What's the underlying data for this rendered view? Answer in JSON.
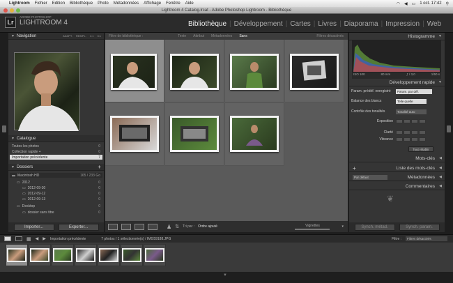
{
  "menubar": {
    "app": "Lightroom",
    "items": [
      "Fichier",
      "Edition",
      "Bibliothèque",
      "Photo",
      "Métadonnées",
      "Affichage",
      "Fenêtre",
      "Aide"
    ],
    "clock": "1 oct. 17:42"
  },
  "window": {
    "title": "Lightroom 4 Catalog.lrcat - Adobe Photoshop Lightroom - Bibliothèque"
  },
  "brand": {
    "logo": "Lr",
    "small": "ADOBE PHOTOSHOP",
    "big": "LIGHTROOM 4"
  },
  "modules": [
    "Bibliothèque",
    "Développement",
    "Cartes",
    "Livres",
    "Diaporama",
    "Impression",
    "Web"
  ],
  "left": {
    "navigation": {
      "title": "Navigation",
      "zooms": [
        "ADAPT.",
        "REMPL.",
        "1:1",
        "3:1"
      ]
    },
    "catalogue": {
      "title": "Catalogue",
      "items": [
        {
          "label": "Toutes les photos",
          "count": "0"
        },
        {
          "label": "Collection rapide +",
          "count": "0"
        },
        {
          "label": "Importation précédente",
          "count": "7"
        }
      ]
    },
    "dossiers": {
      "title": "Dossiers",
      "volume": "Macintosh HD",
      "volume_info": "165 / 233 Go",
      "items": [
        {
          "label": "2012",
          "count": "0"
        },
        {
          "label": "2012-09-30",
          "count": "0"
        },
        {
          "label": "2012-09-12",
          "count": "0"
        },
        {
          "label": "2012-09-13",
          "count": "0"
        },
        {
          "label": "Desktop",
          "count": "0"
        },
        {
          "label": "dossier sans titre",
          "count": "0"
        }
      ]
    },
    "import_label": "Importer...",
    "export_label": "Exporter..."
  },
  "filter": {
    "label": "Filtre de bibliothèque :",
    "items": [
      "Texte",
      "Attribut",
      "Métadonnées",
      "Sans"
    ],
    "status": "Filtres désactivés"
  },
  "toolbar": {
    "sort_label": "Tri par :",
    "sort_value": "Ordre ajouté",
    "thumbs_label": "Vignettes"
  },
  "right": {
    "histogram": {
      "title": "Histogramme",
      "info": [
        "ISO 100",
        "80 mm",
        "ƒ / 3,0",
        "1/50 s"
      ]
    },
    "quick": {
      "title": "Développement rapide",
      "preset_label": "Param. prédéf. enregistré",
      "preset_value": "Param. par déf.",
      "wb_label": "Balance des blancs",
      "wb_value": "Telle quelle",
      "tone_label": "Contrôle des tonalités",
      "tone_value": "Tonalité auto",
      "exposure": "Exposition",
      "clarity": "Clarté",
      "vibrance": "Vibrance",
      "reset": "Tout rétablir"
    },
    "keywords": {
      "title": "Mots-clés"
    },
    "keywordlist": {
      "title": "Liste des mots-clés"
    },
    "metadata": {
      "title": "Métadonnées",
      "preset": "Par défaut"
    },
    "comments": {
      "title": "Commentaires"
    },
    "sync_label": "Synch. métad.",
    "sync2_label": "Synch. param."
  },
  "filmstrip": {
    "source": "Importation précédente",
    "info": "7 photos / 1 sélectionnée(s) / IMG59188.JPG",
    "filter_label": "Filtre :",
    "filter_value": "Filtres désactivés"
  }
}
